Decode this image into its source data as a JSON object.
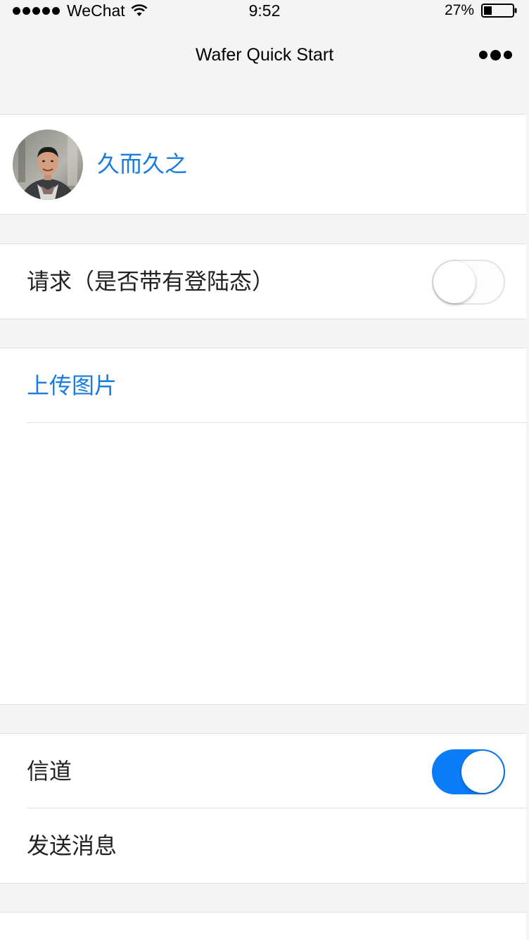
{
  "status_bar": {
    "carrier": "WeChat",
    "time": "9:52",
    "battery": "27%",
    "battery_level": 0.27,
    "signal_icon": "signal-dots-icon",
    "wifi_icon": "wifi-icon",
    "battery_icon": "battery-icon"
  },
  "nav": {
    "title": "Wafer Quick Start",
    "more_icon": "more-dots-icon"
  },
  "user": {
    "nickname": "久而久之"
  },
  "request": {
    "label": "请求（是否带有登陆态）",
    "switch_on": false
  },
  "upload": {
    "label": "上传图片"
  },
  "tunnel": {
    "label": "信道",
    "switch_on": true,
    "send_label": "发送消息"
  },
  "colors": {
    "accent": "#1a7be0",
    "switch_on": "#0a7cf6",
    "background": "#f4f4f4"
  }
}
